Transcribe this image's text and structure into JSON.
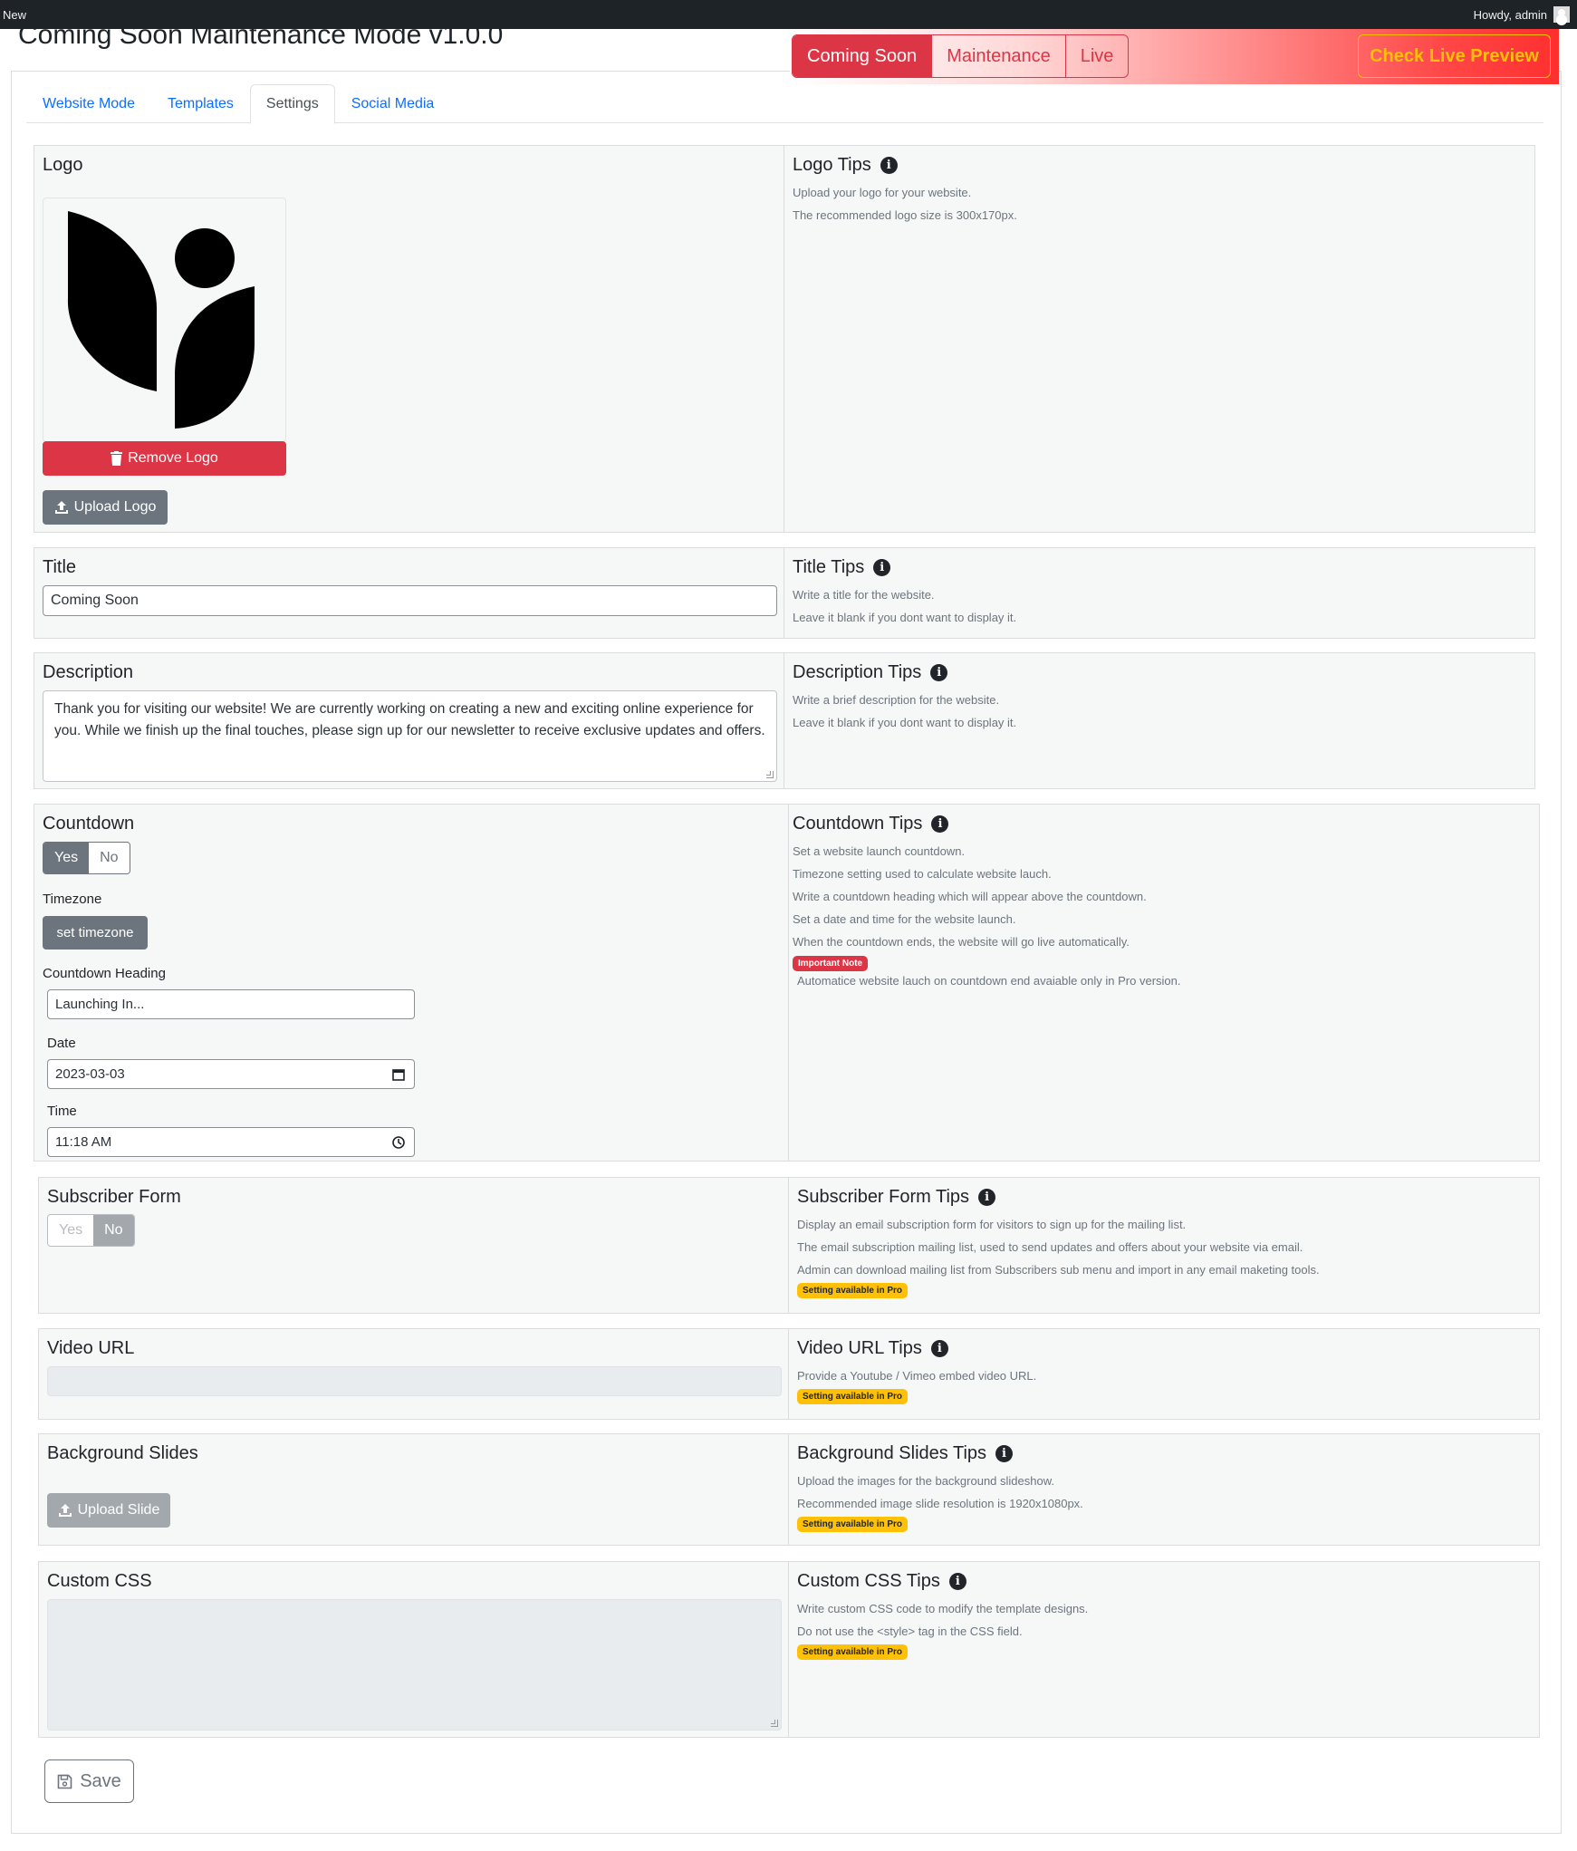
{
  "adminbar": {
    "new_label": "New",
    "howdy": "Howdy, admin"
  },
  "plugin": {
    "title": "Coming Soon Maintenance Mode v1.0.0"
  },
  "modes": {
    "coming_soon": "Coming Soon",
    "maintenance": "Maintenance",
    "live": "Live",
    "active": "Coming Soon"
  },
  "header": {
    "live_preview": "Check Live Preview"
  },
  "tabs": [
    {
      "label": "Website Mode"
    },
    {
      "label": "Templates"
    },
    {
      "label": "Settings"
    },
    {
      "label": "Social Media"
    }
  ],
  "logo": {
    "label": "Logo",
    "remove_button": "Remove Logo",
    "upload_button": "Upload Logo",
    "tips_title": "Logo Tips",
    "tips": [
      "Upload your logo for your website.",
      "The recommended logo size is 300x170px."
    ]
  },
  "title_section": {
    "label": "Title",
    "value": "Coming Soon",
    "tips_title": "Title Tips",
    "tips": [
      "Write a title for the website.",
      "Leave it blank if you dont want to display it."
    ]
  },
  "description": {
    "label": "Description",
    "value": "Thank you for visiting our website! We are currently working on creating a new and exciting online experience for you. While we finish up the final touches, please sign up for our newsletter to receive exclusive updates and offers.",
    "tips_title": "Description Tips",
    "tips": [
      "Write a brief description for the website.",
      "Leave it blank if you dont want to display it."
    ]
  },
  "countdown": {
    "label": "Countdown",
    "yes": "Yes",
    "no": "No",
    "timezone_label": "Timezone",
    "timezone_button": "set timezone",
    "heading_label": "Countdown Heading",
    "heading_value": "Launching In...",
    "date_label": "Date",
    "date_value": "2023-03-03",
    "time_label": "Time",
    "time_value": "11:18 AM",
    "tips_title": "Countdown Tips",
    "tips": [
      "Set a website launch countdown.",
      "Timezone setting used to calculate website lauch.",
      "Write a countdown heading which will appear above the countdown.",
      "Set a date and time for the website launch.",
      "When the countdown ends, the website will go live automatically."
    ],
    "important_badge": "Important Note",
    "important_text": "Automatice website lauch on countdown end avaiable only in Pro version."
  },
  "subscriber": {
    "label": "Subscriber Form",
    "yes": "Yes",
    "no": "No",
    "tips_title": "Subscriber Form Tips",
    "tips": [
      "Display an email subscription form for visitors to sign up for the mailing list.",
      "The email subscription mailing list, used to send updates and offers about your website via email.",
      "Admin can download mailing list from Subscribers sub menu and import in any email maketing tools."
    ],
    "pro_badge": "Setting available in Pro"
  },
  "video": {
    "label": "Video URL",
    "value": "",
    "tips_title": "Video URL Tips",
    "tips": [
      "Provide a Youtube / Vimeo embed video URL."
    ],
    "pro_badge": "Setting available in Pro"
  },
  "slides": {
    "label": "Background Slides",
    "upload_button": "Upload Slide",
    "tips_title": "Background Slides Tips",
    "tips": [
      "Upload the images for the background slideshow.",
      "Recommended image slide resolution is 1920x1080px."
    ],
    "pro_badge": "Setting available in Pro"
  },
  "css": {
    "label": "Custom CSS",
    "value": "",
    "tips_title": "Custom CSS Tips",
    "tips": [
      "Write custom CSS code to modify the template designs.",
      "Do not use the <style> tag in the CSS field."
    ],
    "pro_badge": "Setting available in Pro"
  },
  "footer": {
    "save": "Save"
  },
  "colors": {
    "danger": "#dc3545",
    "warning": "#ffc107",
    "secondary": "#6c757d",
    "primary": "#0d6efd",
    "adminbar": "#1d2327"
  }
}
